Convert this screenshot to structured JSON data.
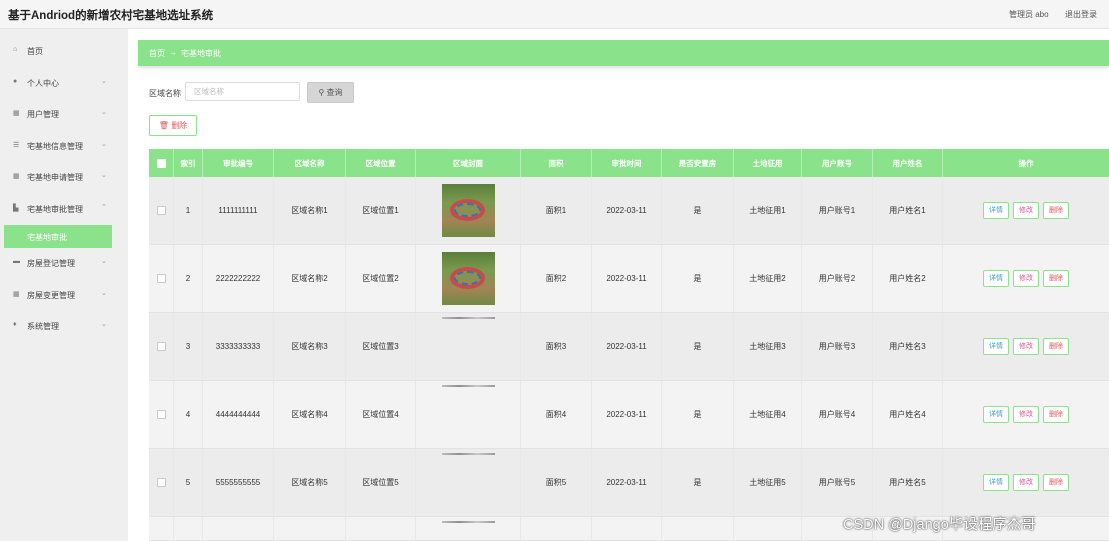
{
  "app": {
    "title": "基于Andriod的新增农村宅基地选址系统",
    "admin": "管理员 abo",
    "logout": "退出登录"
  },
  "sidebar": {
    "items": [
      {
        "label": "首页",
        "icon": "home-icon",
        "chevron": false
      },
      {
        "label": "个人中心",
        "icon": "user-icon",
        "chevron": true
      },
      {
        "label": "用户管理",
        "icon": "grid-icon",
        "chevron": true
      },
      {
        "label": "宅基地信息管理",
        "icon": "list-icon",
        "chevron": true
      },
      {
        "label": "宅基地申请管理",
        "icon": "grid-icon",
        "chevron": true
      },
      {
        "label": "宅基地审批管理",
        "icon": "building-icon",
        "chevron": true
      },
      {
        "label": "房屋登记管理",
        "icon": "card-icon",
        "chevron": true
      },
      {
        "label": "房屋变更管理",
        "icon": "grid-icon",
        "chevron": true
      },
      {
        "label": "系统管理",
        "icon": "pin-icon",
        "chevron": true
      }
    ],
    "active_sub": "宅基地审批"
  },
  "breadcrumb": {
    "home": "首页",
    "sep": "→",
    "current": "宅基地审批"
  },
  "search": {
    "label": "区域名称",
    "placeholder": "区域名称",
    "value": "",
    "button": "查询",
    "button_icon": "search-icon"
  },
  "toolbar": {
    "delete_label": "删除"
  },
  "table": {
    "headers": [
      "索引",
      "审批编号",
      "区域名称",
      "区域位置",
      "区域封面",
      "面积",
      "审批时间",
      "是否安置房",
      "土地征用",
      "用户账号",
      "用户姓名",
      "操作"
    ],
    "rows": [
      {
        "index": "1",
        "code": "1111111111",
        "region": "区域名称1",
        "location": "区域位置1",
        "cover": "full",
        "area": "面积1",
        "time": "2022-03-11",
        "resettle": "是",
        "land": "土地征用1",
        "account": "用户账号1",
        "name": "用户姓名1"
      },
      {
        "index": "2",
        "code": "2222222222",
        "region": "区域名称2",
        "location": "区域位置2",
        "cover": "full",
        "area": "面积2",
        "time": "2022-03-11",
        "resettle": "是",
        "land": "土地征用2",
        "account": "用户账号2",
        "name": "用户姓名2"
      },
      {
        "index": "3",
        "code": "3333333333",
        "region": "区域名称3",
        "location": "区域位置3",
        "cover": "partial",
        "area": "面积3",
        "time": "2022-03-11",
        "resettle": "是",
        "land": "土地征用3",
        "account": "用户账号3",
        "name": "用户姓名3"
      },
      {
        "index": "4",
        "code": "4444444444",
        "region": "区域名称4",
        "location": "区域位置4",
        "cover": "partial",
        "area": "面积4",
        "time": "2022-03-11",
        "resettle": "是",
        "land": "土地征用4",
        "account": "用户账号4",
        "name": "用户姓名4"
      },
      {
        "index": "5",
        "code": "5555555555",
        "region": "区域名称5",
        "location": "区域位置5",
        "cover": "partial",
        "area": "面积5",
        "time": "2022-03-11",
        "resettle": "是",
        "land": "土地征用5",
        "account": "用户账号5",
        "name": "用户姓名5"
      }
    ],
    "actions": {
      "detail": "详情",
      "edit": "修改",
      "delete": "删除"
    }
  },
  "watermark": "CSDN @Django毕设程序杰哥",
  "colors": {
    "accent": "#8ae38a",
    "danger": "#e05a5a",
    "info": "#3aa3c7",
    "edit": "#d65a8e"
  }
}
